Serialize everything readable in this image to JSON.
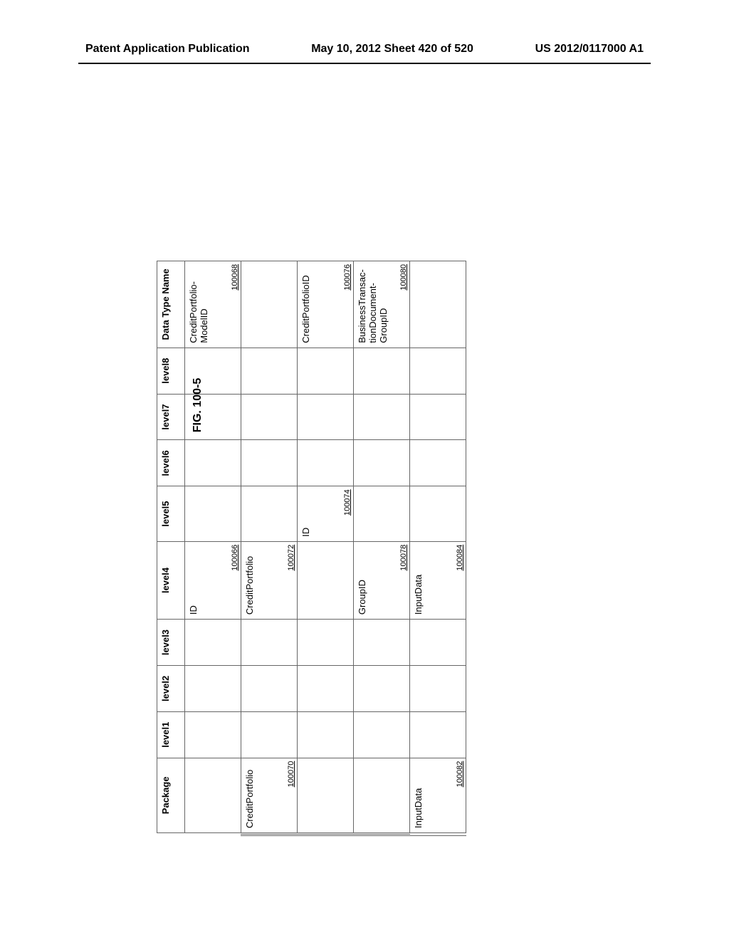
{
  "header": {
    "left": "Patent Application Publication",
    "center": "May 10, 2012  Sheet 420 of 520",
    "right": "US 2012/0117000 A1"
  },
  "figure_title": "FIG. 100-5",
  "table": {
    "headers": [
      "Package",
      "level1",
      "level2",
      "level3",
      "level4",
      "level5",
      "level6",
      "level7",
      "level8",
      "Data Type Name"
    ],
    "rows": [
      {
        "package": "",
        "package_ref": "",
        "level4": "ID",
        "level4_ref": "100066",
        "level5": "",
        "level5_ref": "",
        "dtn": "CreditPortfolio-ModelID",
        "dtn_ref": "100068"
      },
      {
        "package": "CreditPortfolio",
        "package_ref": "100070",
        "level4": "CreditPortfolio",
        "level4_ref": "100072",
        "level5": "",
        "level5_ref": "",
        "dtn": "",
        "dtn_ref": ""
      },
      {
        "package": "",
        "package_ref": "",
        "level4": "",
        "level4_ref": "",
        "level5": "ID",
        "level5_ref": "100074",
        "dtn": "CreditPortfolioID",
        "dtn_ref": "100076"
      },
      {
        "package": "",
        "package_ref": "",
        "level4": "GroupID",
        "level4_ref": "100078",
        "level5": "",
        "level5_ref": "",
        "dtn": "BusinessTransac-tionDocument-GroupID",
        "dtn_ref": "100080"
      },
      {
        "package": "InputData",
        "package_ref": "100082",
        "level4": "InputData",
        "level4_ref": "100084",
        "level5": "",
        "level5_ref": "",
        "dtn": "",
        "dtn_ref": ""
      }
    ]
  }
}
